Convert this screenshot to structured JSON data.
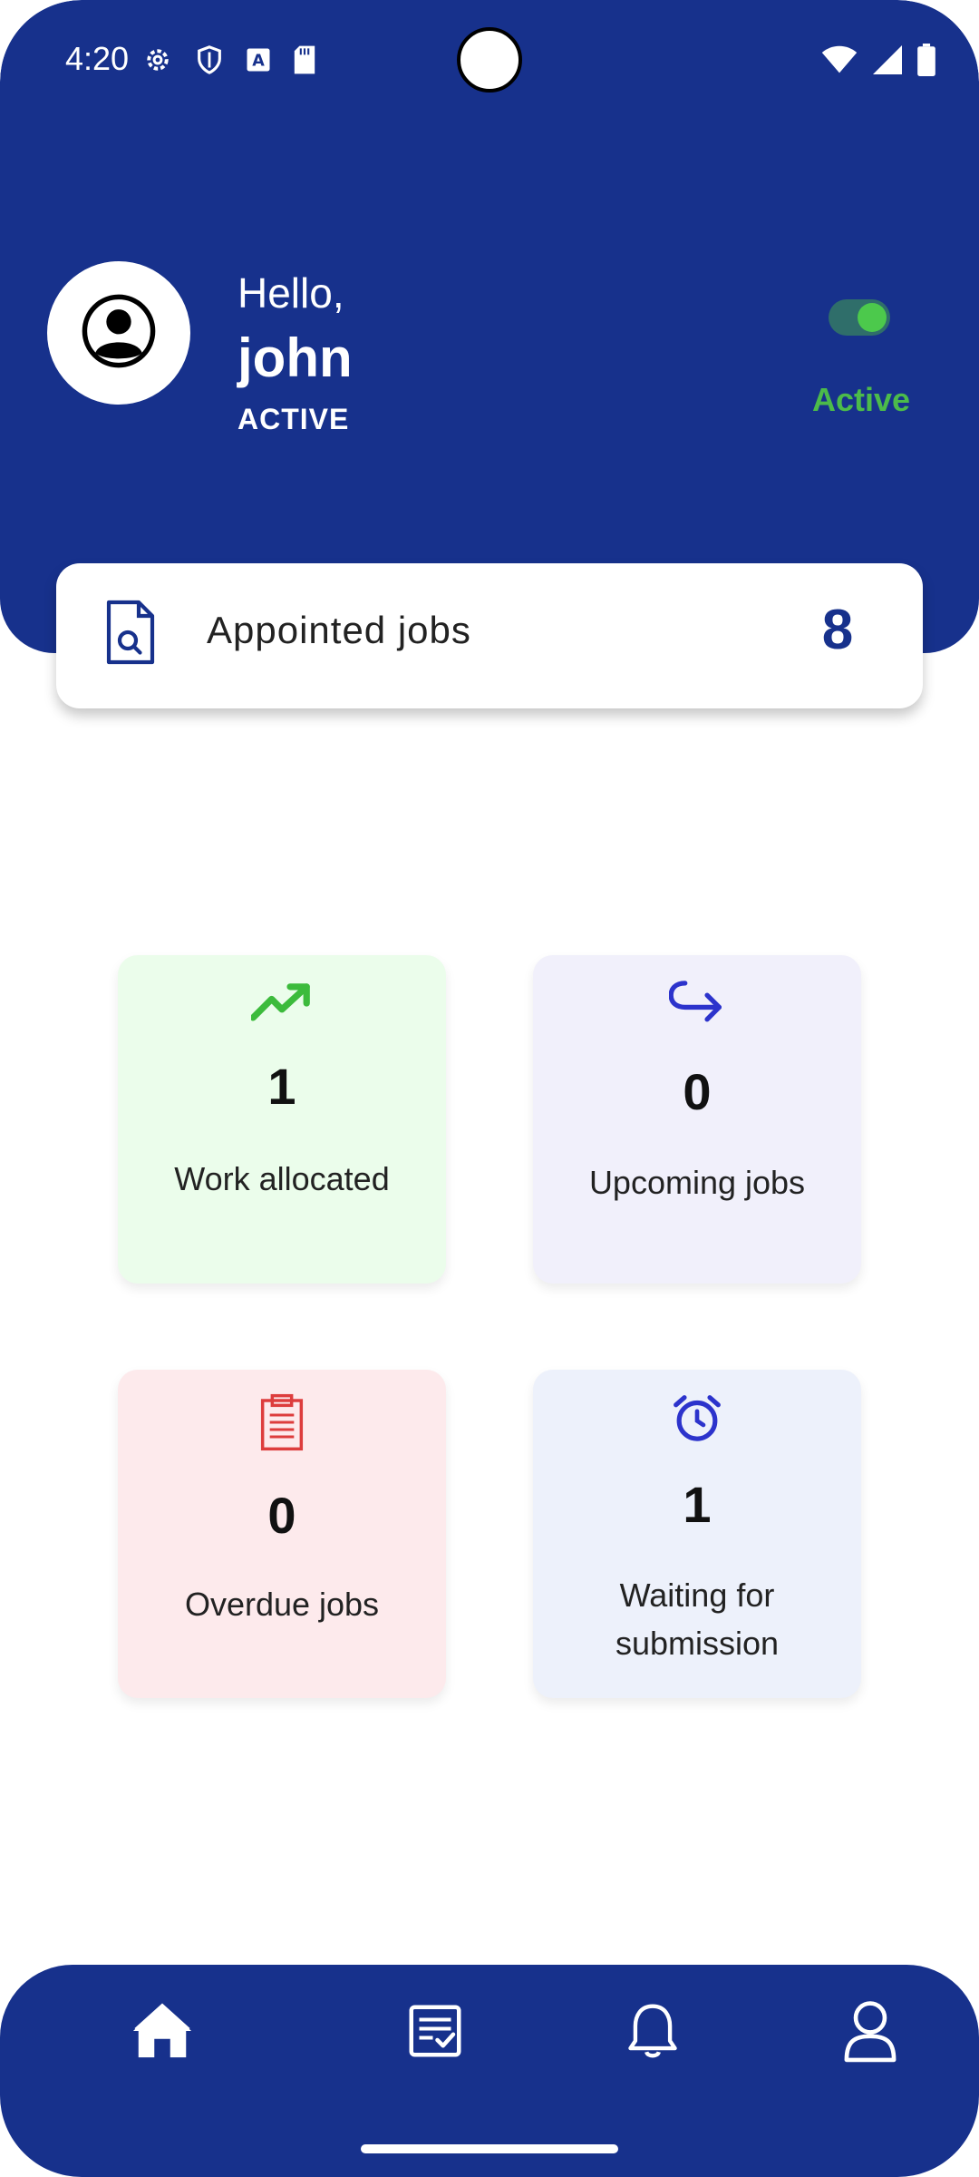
{
  "status_bar": {
    "time": "4:20",
    "left_icons": [
      "gear-icon",
      "shield-icon",
      "a-box-icon",
      "sd-card-icon"
    ],
    "right_icons": [
      "wifi-icon",
      "signal-icon",
      "battery-icon"
    ]
  },
  "header": {
    "greeting": "Hello,",
    "username": "john",
    "user_status": "ACTIVE",
    "toggle_on": true,
    "active_label": "Active"
  },
  "appointed": {
    "label": "Appointed jobs",
    "count": "8"
  },
  "tiles": [
    {
      "count": "1",
      "label": "Work allocated",
      "icon": "trending-up-icon"
    },
    {
      "count": "0",
      "label": "Upcoming jobs",
      "icon": "redo-arrow-icon"
    },
    {
      "count": "0",
      "label": "Overdue jobs",
      "icon": "clipboard-icon"
    },
    {
      "count": "1",
      "label": "Waiting for submission",
      "icon": "alarm-clock-icon"
    }
  ],
  "bottom_nav": {
    "items": [
      "home-icon",
      "tasks-icon",
      "bell-icon",
      "profile-icon"
    ],
    "active_index": 0
  },
  "colors": {
    "primary": "#17318c",
    "active_green": "#4cbb4a",
    "tile_green": "#ebfdeb",
    "tile_lavender": "#f1f0fb",
    "tile_pink": "#fdeaec",
    "tile_blue": "#edf1fb"
  }
}
